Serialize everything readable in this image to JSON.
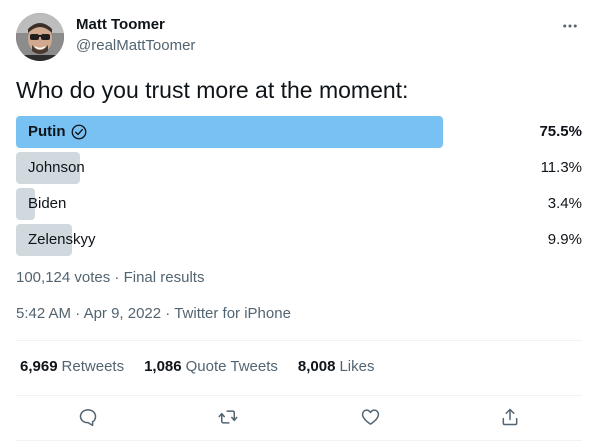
{
  "user": {
    "name": "Matt Toomer",
    "handle": "@realMattToomer"
  },
  "tweet": {
    "text": "Who do you trust more at the moment:"
  },
  "poll": {
    "options": [
      {
        "label": "Putin",
        "percent": "75.5%",
        "fraction": 0.755,
        "winner": true
      },
      {
        "label": "Johnson",
        "percent": "11.3%",
        "fraction": 0.113,
        "winner": false
      },
      {
        "label": "Biden",
        "percent": "3.4%",
        "fraction": 0.034,
        "winner": false
      },
      {
        "label": "Zelenskyy",
        "percent": "9.9%",
        "fraction": 0.099,
        "winner": false
      }
    ],
    "votes": "100,124 votes",
    "status": "Final results",
    "winner_color": "#78c1f3",
    "option_color": "#cfd9de"
  },
  "timestamp": {
    "time": "5:42 AM",
    "date": "Apr 9, 2022",
    "source": "Twitter for iPhone"
  },
  "stats": {
    "retweets_count": "6,969",
    "retweets_label": "Retweets",
    "quotes_count": "1,086",
    "quotes_label": "Quote Tweets",
    "likes_count": "8,008",
    "likes_label": "Likes"
  },
  "icons": {
    "more": "more-horizontal-icon",
    "reply": "reply-icon",
    "retweet": "retweet-icon",
    "like": "like-icon",
    "share": "share-icon",
    "winner_check": "check-circle-icon"
  }
}
